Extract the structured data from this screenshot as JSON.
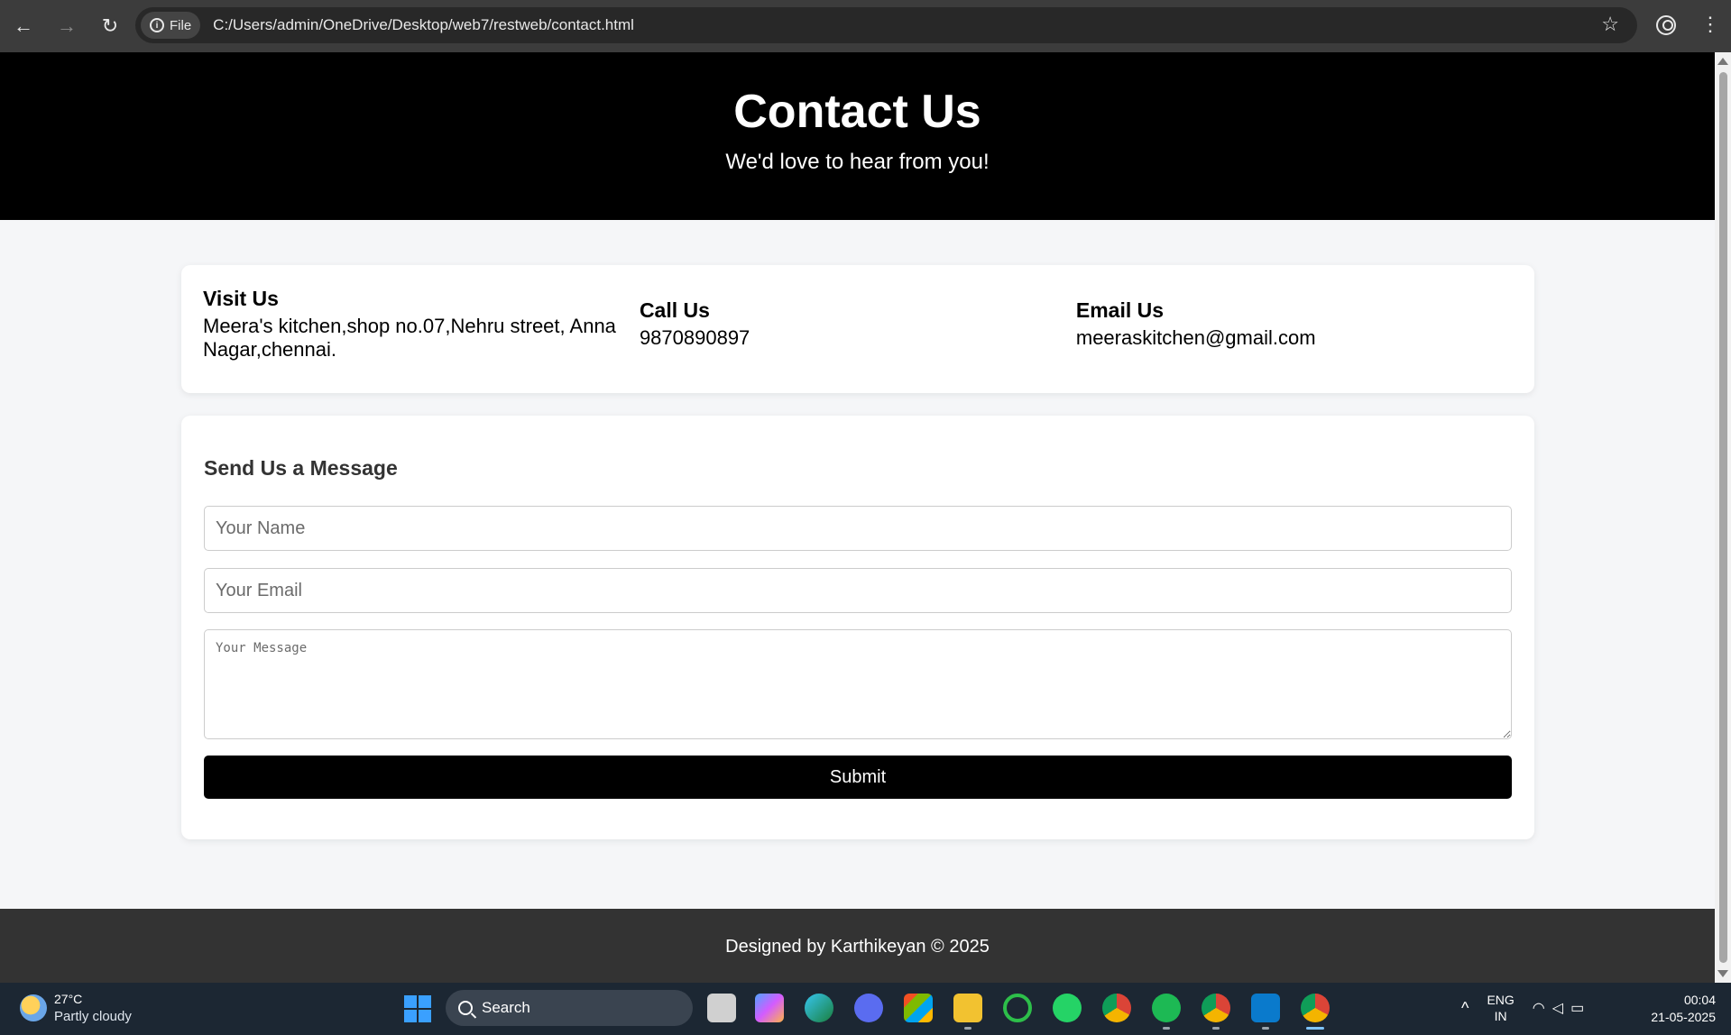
{
  "browser": {
    "file_chip": "File",
    "url": "C:/Users/admin/OneDrive/Desktop/web7/restweb/contact.html"
  },
  "hero": {
    "title": "Contact Us",
    "subtitle": "We'd love to hear from you!"
  },
  "info": {
    "visit": {
      "heading": "Visit Us",
      "text": "Meera's kitchen,shop no.07,Nehru street, Anna Nagar,chennai."
    },
    "call": {
      "heading": "Call Us",
      "text": "9870890897"
    },
    "email": {
      "heading": "Email Us",
      "text": "meeraskitchen@gmail.com"
    }
  },
  "form": {
    "title": "Send Us a Message",
    "name_placeholder": "Your Name",
    "email_placeholder": "Your Email",
    "message_placeholder": "Your Message",
    "submit_label": "Submit"
  },
  "footer": {
    "text": "Designed by Karthikeyan © 2025"
  },
  "taskbar": {
    "weather_temp": "27°C",
    "weather_desc": "Partly cloudy",
    "search_label": "Search",
    "lang_line1": "ENG",
    "lang_line2": "IN",
    "time": "00:04",
    "date": "21-05-2025"
  },
  "colors": {
    "hero_bg": "#000000",
    "submit_bg": "#000000",
    "footer_bg": "#333333",
    "page_bg": "#f5f6f8"
  }
}
